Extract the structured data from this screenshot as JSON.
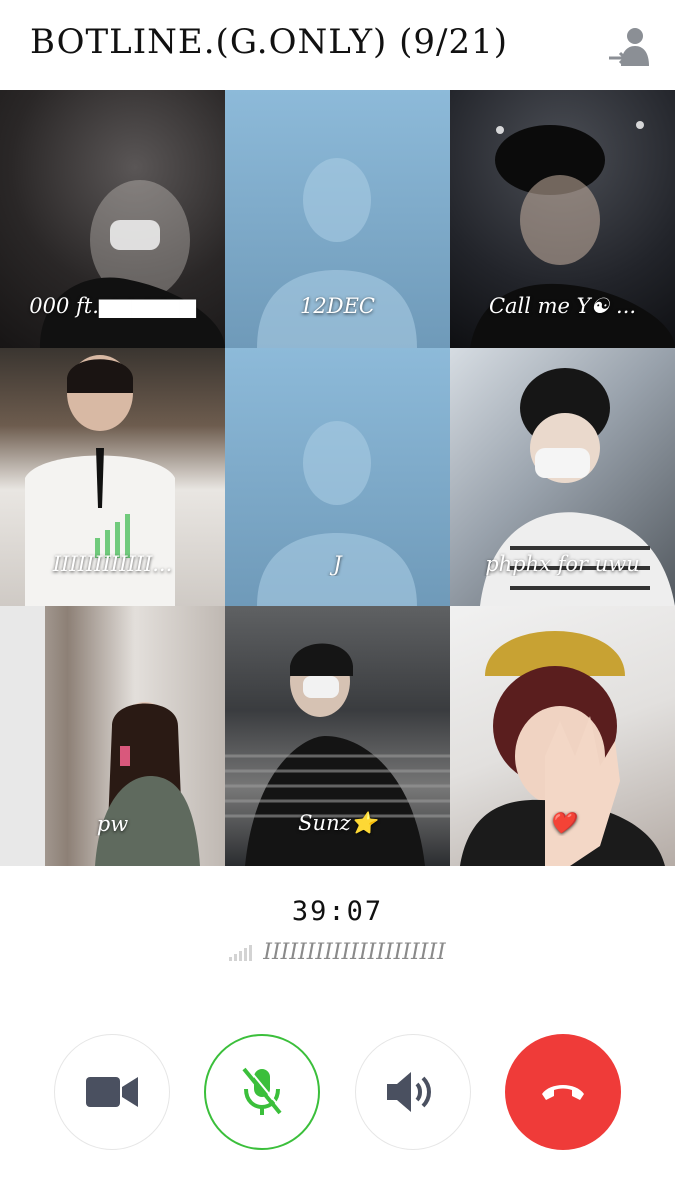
{
  "header": {
    "title": "BOTLINE.(G.ONLY) (9/21)",
    "action_icon": "exit-user-icon"
  },
  "participants": [
    {
      "label": "000 ft.▆▆▆▆▆▆"
    },
    {
      "label": "12DEC"
    },
    {
      "label": "Call me Y☯ ..."
    },
    {
      "label": "IIIIIIIIIIII..."
    },
    {
      "label": "J"
    },
    {
      "label": "phphx for uwu"
    },
    {
      "label": "pw"
    },
    {
      "label": "Sunz⭐"
    },
    {
      "label": "❤️"
    }
  ],
  "call": {
    "timer": "39:07",
    "speaker": "IIIIIIIIIIIIIIIIIIIII"
  },
  "controls": {
    "video_icon": "video-camera-icon",
    "mic_icon": "mic-muted-icon",
    "speaker_icon": "speaker-icon",
    "end_icon": "end-call-icon"
  },
  "colors": {
    "mic_active": "#3bbf3b",
    "end_call": "#ef3b39",
    "icon_gray": "#4a5060",
    "placeholder_bg": "#8dbad9"
  }
}
